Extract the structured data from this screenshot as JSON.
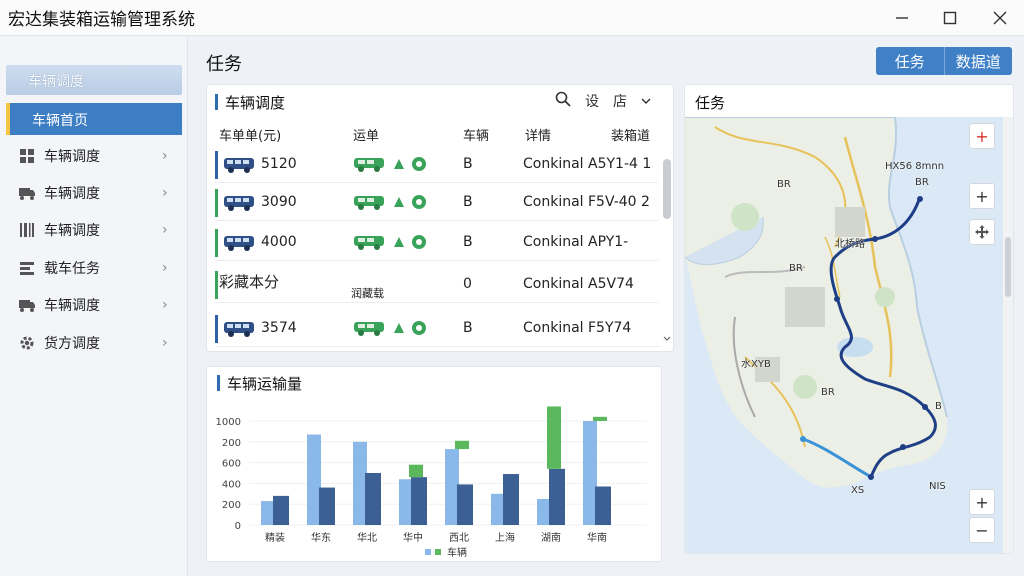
{
  "window": {
    "title": "宏达集装箱运输管理系统"
  },
  "sidebar": {
    "header": "车辆调度",
    "active": "车辆首页",
    "items": [
      {
        "label": "车辆调度",
        "icon": "grid-icon"
      },
      {
        "label": "车辆调度",
        "icon": "truck-icon"
      },
      {
        "label": "车辆调度",
        "icon": "barcode-icon"
      },
      {
        "label": "载车任务",
        "icon": "list-icon"
      },
      {
        "label": "车辆调度",
        "icon": "truck-icon"
      },
      {
        "label": "货方调度",
        "icon": "settings-icon"
      }
    ]
  },
  "main": {
    "title": "任务",
    "tabs": [
      "任务",
      "数据道"
    ]
  },
  "table_panel": {
    "title": "车辆调度",
    "tools": [
      "search-icon",
      "设",
      "店"
    ],
    "columns": [
      "车单单(元)",
      "运单",
      "车辆",
      "详情",
      "装箱道"
    ],
    "rows": [
      {
        "number": "5120",
        "grade": "B",
        "detail": "Conkinal A5Y1-4 1",
        "mark": "#2f5fa7",
        "has_icons": true
      },
      {
        "number": "3090",
        "grade": "B",
        "detail": "Conkinal F5V-40 2",
        "mark": "#3aa35a",
        "has_icons": true
      },
      {
        "number": "4000",
        "grade": "B",
        "detail": "Conkinal APY1-",
        "mark": "#3aa35a",
        "has_icons": true
      },
      {
        "number": "彩藏本分",
        "sub": "润藏载",
        "grade": "0",
        "detail": "Conkinal A5V74",
        "mark": "#3aa35a",
        "has_icons": false
      },
      {
        "number": "3574",
        "grade": "B",
        "detail": "Conkinal F5Y74",
        "mark": "#2f5fa7",
        "has_icons": true
      }
    ]
  },
  "chart_panel": {
    "title": "车辆运输量",
    "legend_label": "车辆"
  },
  "chart_data": {
    "type": "bar",
    "categories": [
      "精装",
      "华东",
      "华北",
      "华中",
      "西北",
      "上海",
      "湖南",
      "华南"
    ],
    "series": [
      {
        "values": [
          230,
          870,
          800,
          440,
          730,
          300,
          250,
          1000
        ],
        "color": "#8ab8e8"
      },
      {
        "values": [
          280,
          360,
          500,
          460,
          390,
          490,
          540,
          370
        ],
        "color": "#3c5f94"
      },
      {
        "values": [
          0,
          0,
          0,
          120,
          80,
          0,
          600,
          40
        ],
        "color": "#5cb85c"
      }
    ],
    "yticks": [
      "0",
      "200",
      "400",
      "600",
      "200",
      "1000"
    ],
    "ylim": [
      0,
      1000
    ]
  },
  "map_panel": {
    "title": "任务",
    "labels": [
      "HX56 8mnn",
      "BR",
      "北桥路",
      "BR",
      "BR",
      "水XYB",
      "BR",
      "B",
      "XS",
      "NIS"
    ],
    "controls": [
      "+",
      "−"
    ]
  },
  "colors": {
    "accent": "#3c7dc4",
    "route": "#1e3f86"
  }
}
